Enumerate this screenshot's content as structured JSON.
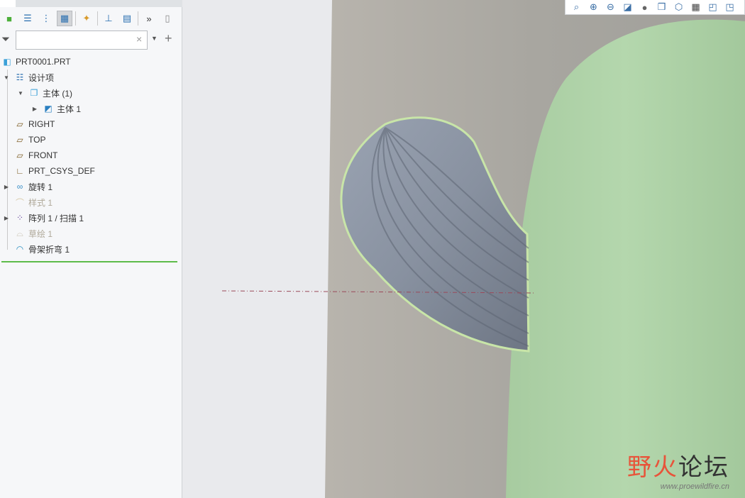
{
  "model_tree": {
    "filter_placeholder": "",
    "items": [
      {
        "label": "PRT0001.PRT",
        "icon": "part-icon"
      },
      {
        "label": "设计项",
        "icon": "design-items-icon"
      },
      {
        "label": "主体 (1)",
        "icon": "bodies-icon"
      },
      {
        "label": "主体 1",
        "icon": "body-icon"
      },
      {
        "label": "RIGHT",
        "icon": "datum-plane-icon"
      },
      {
        "label": "TOP",
        "icon": "datum-plane-icon"
      },
      {
        "label": "FRONT",
        "icon": "datum-plane-icon"
      },
      {
        "label": "PRT_CSYS_DEF",
        "icon": "csys-icon"
      },
      {
        "label": "旋转 1",
        "icon": "revolve-icon"
      },
      {
        "label": "样式 1",
        "icon": "style-icon"
      },
      {
        "label": "阵列 1 / 扫描 1",
        "icon": "pattern-icon"
      },
      {
        "label": "草绘 1",
        "icon": "sketch-icon"
      },
      {
        "label": "骨架折弯 1",
        "icon": "spinal-bend-icon"
      }
    ]
  },
  "watermark": {
    "title_a": "野火",
    "title_b": "论坛",
    "url": "www.proewildfire.cn"
  },
  "colors": {
    "accent": "#5dbb4a",
    "model": "#8e97a6",
    "cactus": "#a9cfa0"
  }
}
